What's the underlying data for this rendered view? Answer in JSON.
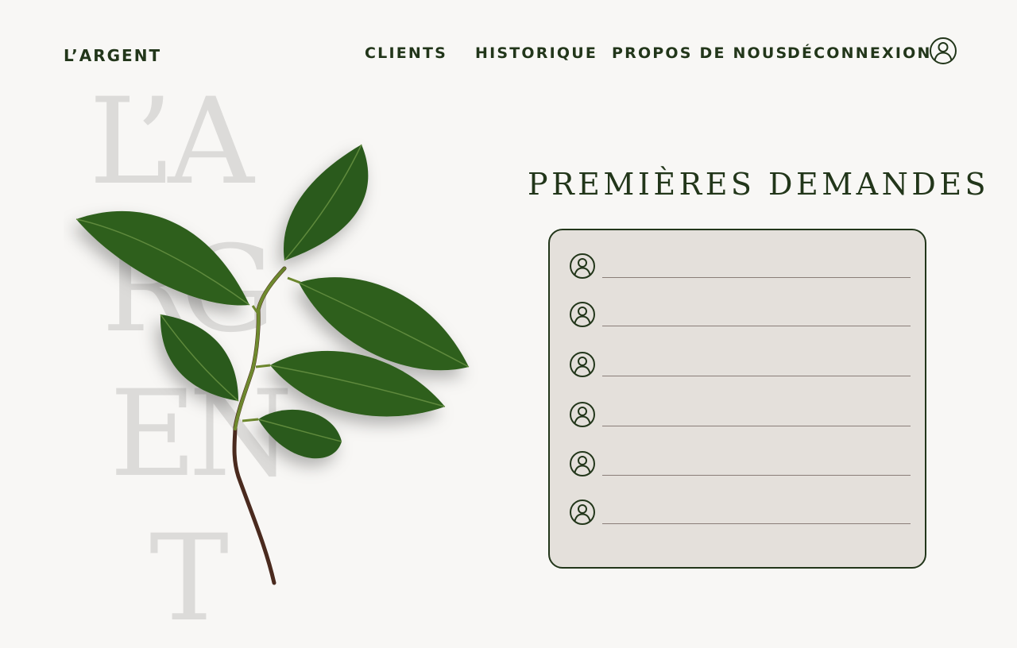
{
  "header": {
    "brand": "L’ARGENT",
    "nav": [
      {
        "label": "CLIENTS"
      },
      {
        "label": "HISTORIQUE"
      },
      {
        "label": "PROPOS DE NOUS"
      },
      {
        "label": "DÉCONNEXION"
      }
    ],
    "profile_icon": "user-circle-icon"
  },
  "decorative_text": {
    "line1": "L’A",
    "line2": "RG",
    "line3": "EN",
    "line4": "T"
  },
  "main": {
    "title": "PREMIÈRES DEMANDES",
    "requests": [
      {
        "name": "",
        "icon": "user-circle-icon"
      },
      {
        "name": "",
        "icon": "user-circle-icon"
      },
      {
        "name": "",
        "icon": "user-circle-icon"
      },
      {
        "name": "",
        "icon": "user-circle-icon"
      },
      {
        "name": "",
        "icon": "user-circle-icon"
      },
      {
        "name": "",
        "icon": "user-circle-icon"
      }
    ]
  },
  "colors": {
    "primary": "#22361a",
    "background": "#f8f7f5",
    "card": "#e4e0db",
    "line": "#8a7e78",
    "watermark": "#dcdbd9"
  }
}
